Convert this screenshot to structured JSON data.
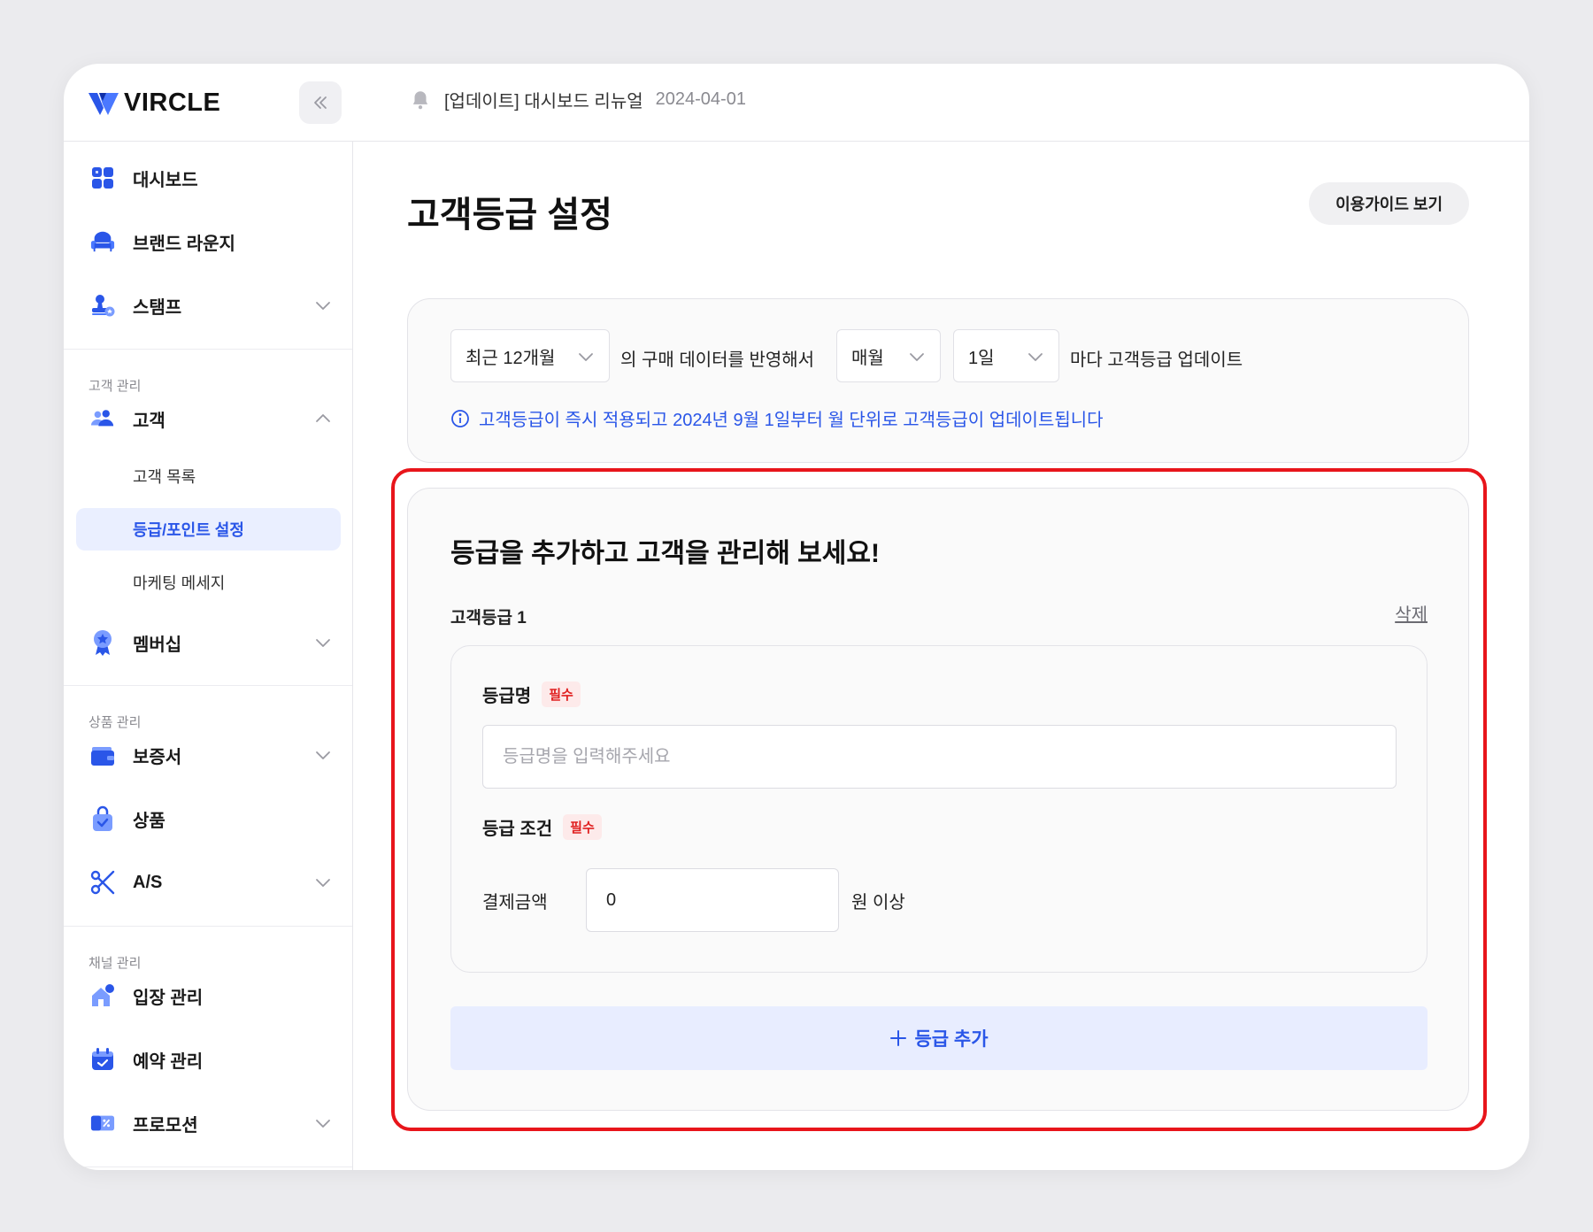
{
  "brand": {
    "name": "VIRCLE"
  },
  "notice": {
    "text": "[업데이트] 대시보드 리뉴얼",
    "date": "2024-04-01"
  },
  "sidebar": {
    "items_top": [
      {
        "label": "대시보드",
        "icon": "dashboard-icon"
      },
      {
        "label": "브랜드 라운지",
        "icon": "sofa-icon"
      },
      {
        "label": "스탬프",
        "icon": "stamp-icon"
      }
    ],
    "section_customer": "고객 관리",
    "customer": {
      "label": "고객",
      "icon": "users-icon"
    },
    "customer_sub": [
      "고객 목록",
      "등급/포인트 설정",
      "마케팅 메세지"
    ],
    "membership": {
      "label": "멤버십",
      "icon": "medal-icon"
    },
    "section_product": "상품 관리",
    "product_items": [
      {
        "label": "보증서",
        "icon": "wallet-icon"
      },
      {
        "label": "상품",
        "icon": "bag-icon"
      },
      {
        "label": "A/S",
        "icon": "scissors-icon"
      }
    ],
    "section_channel": "채널 관리",
    "channel_items": [
      {
        "label": "입장 관리",
        "icon": "store-icon"
      },
      {
        "label": "예약 관리",
        "icon": "calendar-icon"
      },
      {
        "label": "프로모션",
        "icon": "coupon-icon"
      }
    ]
  },
  "page": {
    "title": "고객등급 설정",
    "guide_button": "이용가이드 보기"
  },
  "update_setting": {
    "period": "최근 12개월",
    "text1": "의 구매 데이터를 반영해서",
    "frequency": "매월",
    "day": "1일",
    "text2": "마다 고객등급 업데이트",
    "info": "고객등급이 즉시 적용되고 2024년 9월 1일부터 월 단위로 고객등급이 업데이트됩니다"
  },
  "grades": {
    "heading": "등급을 추가하고 고객을 관리해 보세요!",
    "grade_label": "고객등급 1",
    "delete_label": "삭제",
    "name_label": "등급명",
    "required_badge": "필수",
    "name_placeholder": "등급명을 입력해주세요",
    "condition_label": "등급 조건",
    "payment_label": "결제금액",
    "payment_value": "0",
    "payment_suffix": "원 이상",
    "add_button": "등급 추가"
  },
  "colors": {
    "accent": "#2a56e8",
    "highlight": "#e8151b",
    "required": "#e02020"
  }
}
